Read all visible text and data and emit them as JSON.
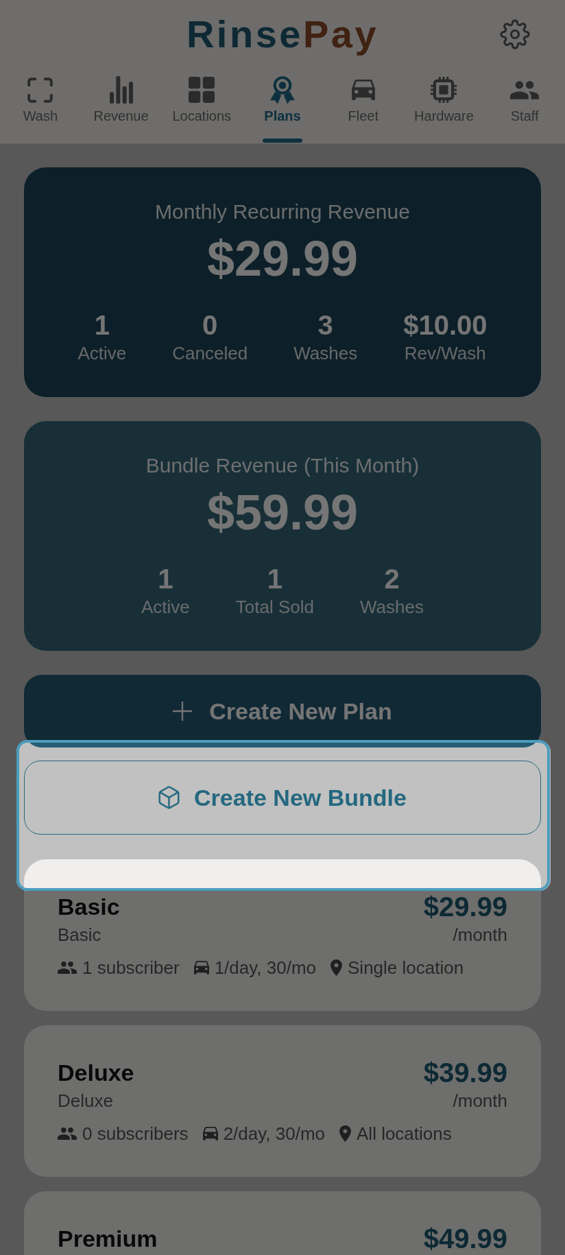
{
  "header": {
    "logo": {
      "primary": "Rinse",
      "accent": "Pay"
    }
  },
  "tabs": [
    {
      "label": "Wash",
      "selected": false
    },
    {
      "label": "Revenue",
      "selected": false
    },
    {
      "label": "Locations",
      "selected": false
    },
    {
      "label": "Plans",
      "selected": true
    },
    {
      "label": "Fleet",
      "selected": false
    },
    {
      "label": "Hardware",
      "selected": false
    },
    {
      "label": "Staff",
      "selected": false
    }
  ],
  "summaries": [
    {
      "title": "Monthly Recurring Revenue",
      "amount": "$29.99",
      "stats": [
        {
          "value": "1",
          "label": "Active"
        },
        {
          "value": "0",
          "label": "Canceled"
        },
        {
          "value": "3",
          "label": "Washes"
        },
        {
          "value": "$10.00",
          "label": "Rev/Wash"
        }
      ]
    },
    {
      "title": "Bundle Revenue (This Month)",
      "amount": "$59.99",
      "stats": [
        {
          "value": "1",
          "label": "Active"
        },
        {
          "value": "1",
          "label": "Total Sold"
        },
        {
          "value": "2",
          "label": "Washes"
        }
      ]
    }
  ],
  "actions": [
    {
      "kind": "primary",
      "label": "Create New Plan",
      "highlighted": false
    },
    {
      "kind": "outline",
      "label": "Create New Bundle",
      "highlighted": true
    }
  ],
  "plans": [
    {
      "name": "Basic",
      "description": "Basic",
      "price": "$29.99",
      "period": "/month",
      "features": [
        {
          "kind": "subscribers",
          "text": "1 subscriber"
        },
        {
          "kind": "visits",
          "text": "1/day, 30/mo"
        },
        {
          "kind": "locations",
          "text": "Single location"
        }
      ]
    },
    {
      "name": "Deluxe",
      "description": "Deluxe",
      "price": "$39.99",
      "period": "/month",
      "features": [
        {
          "kind": "subscribers",
          "text": "0 subscribers"
        },
        {
          "kind": "visits",
          "text": "2/day, 30/mo"
        },
        {
          "kind": "locations",
          "text": "All locations"
        }
      ]
    },
    {
      "name": "Premium",
      "price": "$49.99"
    }
  ]
}
